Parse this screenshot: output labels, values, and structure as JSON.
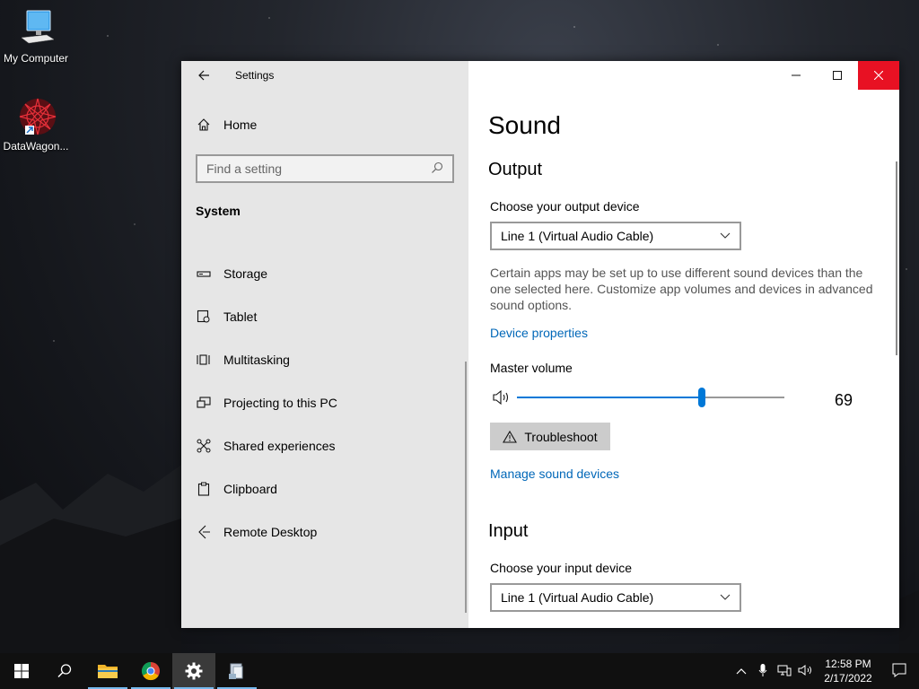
{
  "desktop": {
    "icons": [
      {
        "label": "My Computer"
      },
      {
        "label": "DataWagon..."
      }
    ]
  },
  "settings": {
    "window_title": "Settings",
    "sidebar": {
      "home_label": "Home",
      "search_placeholder": "Find a setting",
      "section": "System",
      "items": [
        {
          "label": "Storage",
          "icon": "storage-icon"
        },
        {
          "label": "Tablet",
          "icon": "tablet-icon"
        },
        {
          "label": "Multitasking",
          "icon": "multitasking-icon"
        },
        {
          "label": "Projecting to this PC",
          "icon": "projecting-icon"
        },
        {
          "label": "Shared experiences",
          "icon": "shared-experiences-icon"
        },
        {
          "label": "Clipboard",
          "icon": "clipboard-icon"
        },
        {
          "label": "Remote Desktop",
          "icon": "remote-desktop-icon"
        }
      ]
    },
    "content": {
      "title": "Sound",
      "output": {
        "heading": "Output",
        "device_label": "Choose your output device",
        "device_value": "Line 1 (Virtual Audio Cable)",
        "description": "Certain apps may be set up to use different sound devices than the one selected here. Customize app volumes and devices in advanced sound options.",
        "device_properties_link": "Device properties",
        "master_volume_label": "Master volume",
        "master_volume_value": 69,
        "master_volume_text": "69",
        "troubleshoot_label": "Troubleshoot",
        "manage_devices_link": "Manage sound devices"
      },
      "input": {
        "heading": "Input",
        "device_label": "Choose your input device",
        "device_value": "Line 1 (Virtual Audio Cable)"
      }
    }
  },
  "taskbar": {
    "time": "12:58 PM",
    "date": "2/17/2022"
  },
  "colors": {
    "accent": "#0078d7",
    "link": "#0067b8",
    "close": "#e81123"
  }
}
